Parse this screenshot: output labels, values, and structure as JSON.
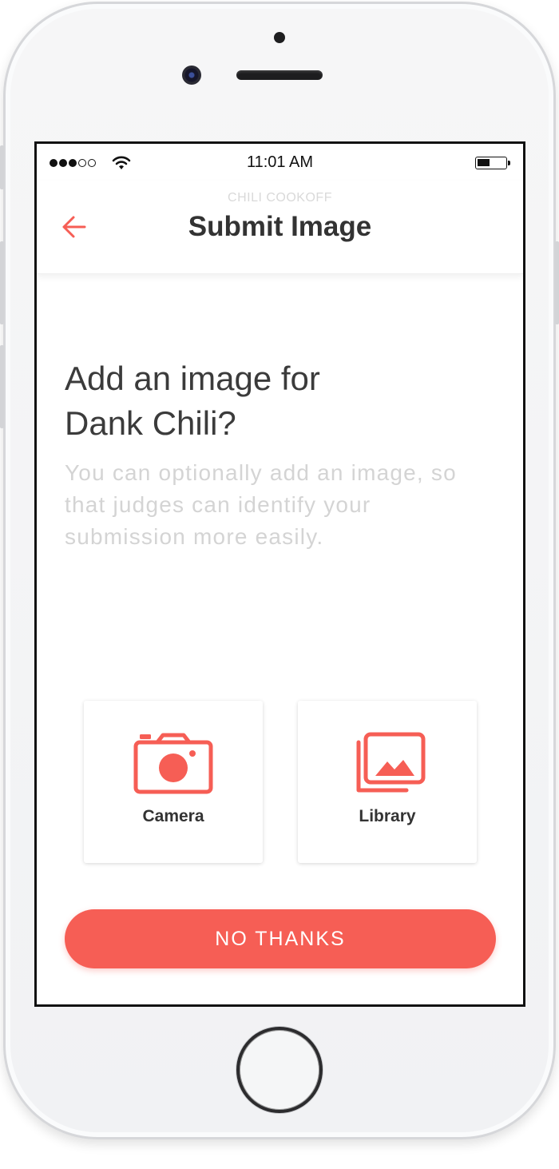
{
  "status_bar": {
    "time": "11:01 AM",
    "signal_icon": "signal-dots-icon",
    "wifi_icon": "wifi-icon",
    "battery_icon": "battery-icon"
  },
  "nav": {
    "eyebrow": "CHILI COOKOFF",
    "title": "Submit Image",
    "back_icon": "arrow-left-icon"
  },
  "content": {
    "heading_line1": "Add an image for",
    "heading_line2": "Dank Chili?",
    "description": "You can optionally add an image, so that judges can identify your submission more easily."
  },
  "options": [
    {
      "label": "Camera",
      "icon": "camera-icon"
    },
    {
      "label": "Library",
      "icon": "photo-library-icon"
    }
  ],
  "cta": {
    "label": "NO THANKS"
  },
  "colors": {
    "accent": "#f65e55",
    "title_text": "#333333",
    "muted_text": "#d4d4d4"
  }
}
